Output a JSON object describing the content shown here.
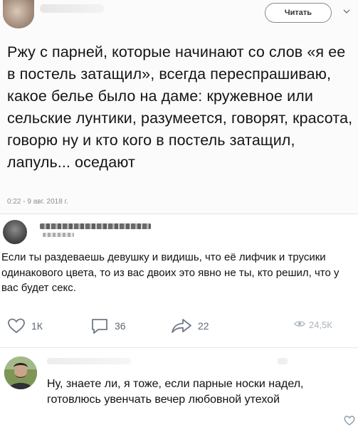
{
  "tweet": {
    "follow_label": "Читать",
    "text": "Ржу с парней, которые начинают со слов «я ее в постель затащил», всегда переспрашиваю, какое белье было на даме: кружевное или сельские лунтики, разумеется, говорят, красота, говорю ну и кто кого в постель затащил, лапуль... оседают",
    "date": "0:22 - 9 авг. 2018 г."
  },
  "post": {
    "text": "Если ты раздеваешь девушку и видишь, что её лифчик и трусики одинакового цвета, то из вас двоих это явно не ты, кто решил, что у вас будет секс.",
    "actions": {
      "likes": "1К",
      "comments": "36",
      "shares": "22",
      "views": "24,5К"
    }
  },
  "comment": {
    "text": "Ну, знаете ли, я тоже, если парные носки надел, готовлюсь увенчать вечер любовной утехой"
  },
  "colors": {
    "action_icon": "#6f7a86",
    "views_icon": "#a9b2bb",
    "date": "#8d8d8d"
  },
  "icons": {
    "avatar_tweet": "avatar",
    "chevron": "chevron-down-icon",
    "like": "heart-icon",
    "comment": "comment-icon",
    "share": "share-icon",
    "views": "eye-icon",
    "comment_like": "heart-icon"
  }
}
